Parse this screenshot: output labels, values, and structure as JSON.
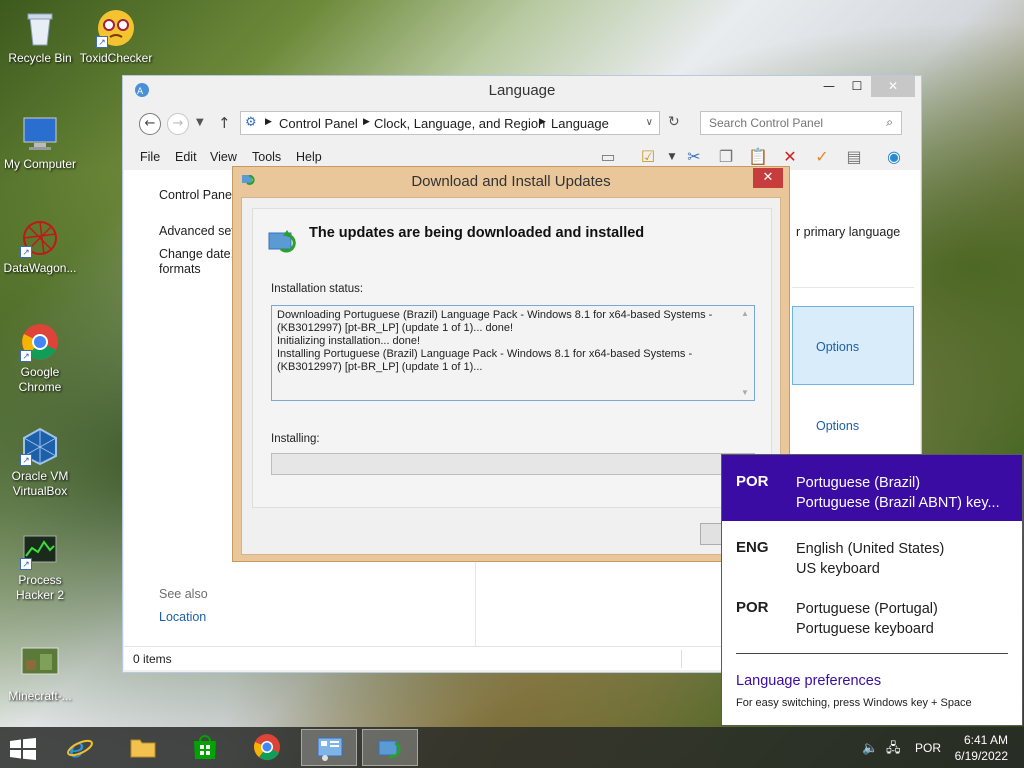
{
  "desktop": {
    "icons": [
      {
        "label": "Recycle Bin"
      },
      {
        "label": "ToxidChecker"
      },
      {
        "label": "My Computer"
      },
      {
        "label": "DataWagon..."
      },
      {
        "label": "Google Chrome"
      },
      {
        "label": "Oracle VM VirtualBox"
      },
      {
        "label": "Process Hacker 2"
      },
      {
        "label": "Minecraft-..."
      }
    ]
  },
  "language_window": {
    "title": "Language",
    "breadcrumb": [
      "Control Panel",
      "Clock, Language, and Region",
      "Language"
    ],
    "search_placeholder": "Search Control Panel",
    "menu": [
      "File",
      "Edit",
      "View",
      "Tools",
      "Help"
    ],
    "left_pane": {
      "control_panel_home": "Control Panel",
      "advanced_settings": "Advanced sett",
      "change_date_line1": "Change date,",
      "change_date_line2": "formats",
      "see_also": "See also",
      "location": "Location"
    },
    "right_pane": {
      "primary_language_text": "r primary language",
      "options_1": "Options",
      "options_2": "Options"
    },
    "status_bar": "0 items"
  },
  "download_dialog": {
    "title": "Download and Install Updates",
    "heading": "The updates are being downloaded and installed",
    "installation_status_label": "Installation status:",
    "status_lines": [
      "Downloading Portuguese (Brazil) Language Pack - Windows 8.1 for x64-based Systems -",
      "(KB3012997) [pt-BR_LP] (update 1 of 1)... done!",
      "Initializing installation... done!",
      "Installing Portuguese (Brazil) Language Pack - Windows 8.1 for x64-based Systems -",
      "(KB3012997) [pt-BR_LP] (update 1 of 1)..."
    ],
    "installing_label": "Installing:",
    "progress_fraction": 0
  },
  "language_flyout": {
    "languages": [
      {
        "code": "POR",
        "name": "Portuguese (Brazil)",
        "keyboard": "Portuguese (Brazil ABNT) key..."
      },
      {
        "code": "ENG",
        "name": "English (United States)",
        "keyboard": "US keyboard"
      },
      {
        "code": "POR",
        "name": "Portuguese (Portugal)",
        "keyboard": "Portuguese keyboard"
      }
    ],
    "preferences_link": "Language preferences",
    "hint": "For easy switching, press Windows key + Space"
  },
  "taskbar": {
    "input_indicator": "POR",
    "time": "6:41 AM",
    "date": "6/19/2022"
  },
  "colors": {
    "flyout_active": "#3a0ca3",
    "dialog_frame": "#e9c79a",
    "link_blue": "#1c5fa8",
    "close_red": "#c73c3c"
  }
}
